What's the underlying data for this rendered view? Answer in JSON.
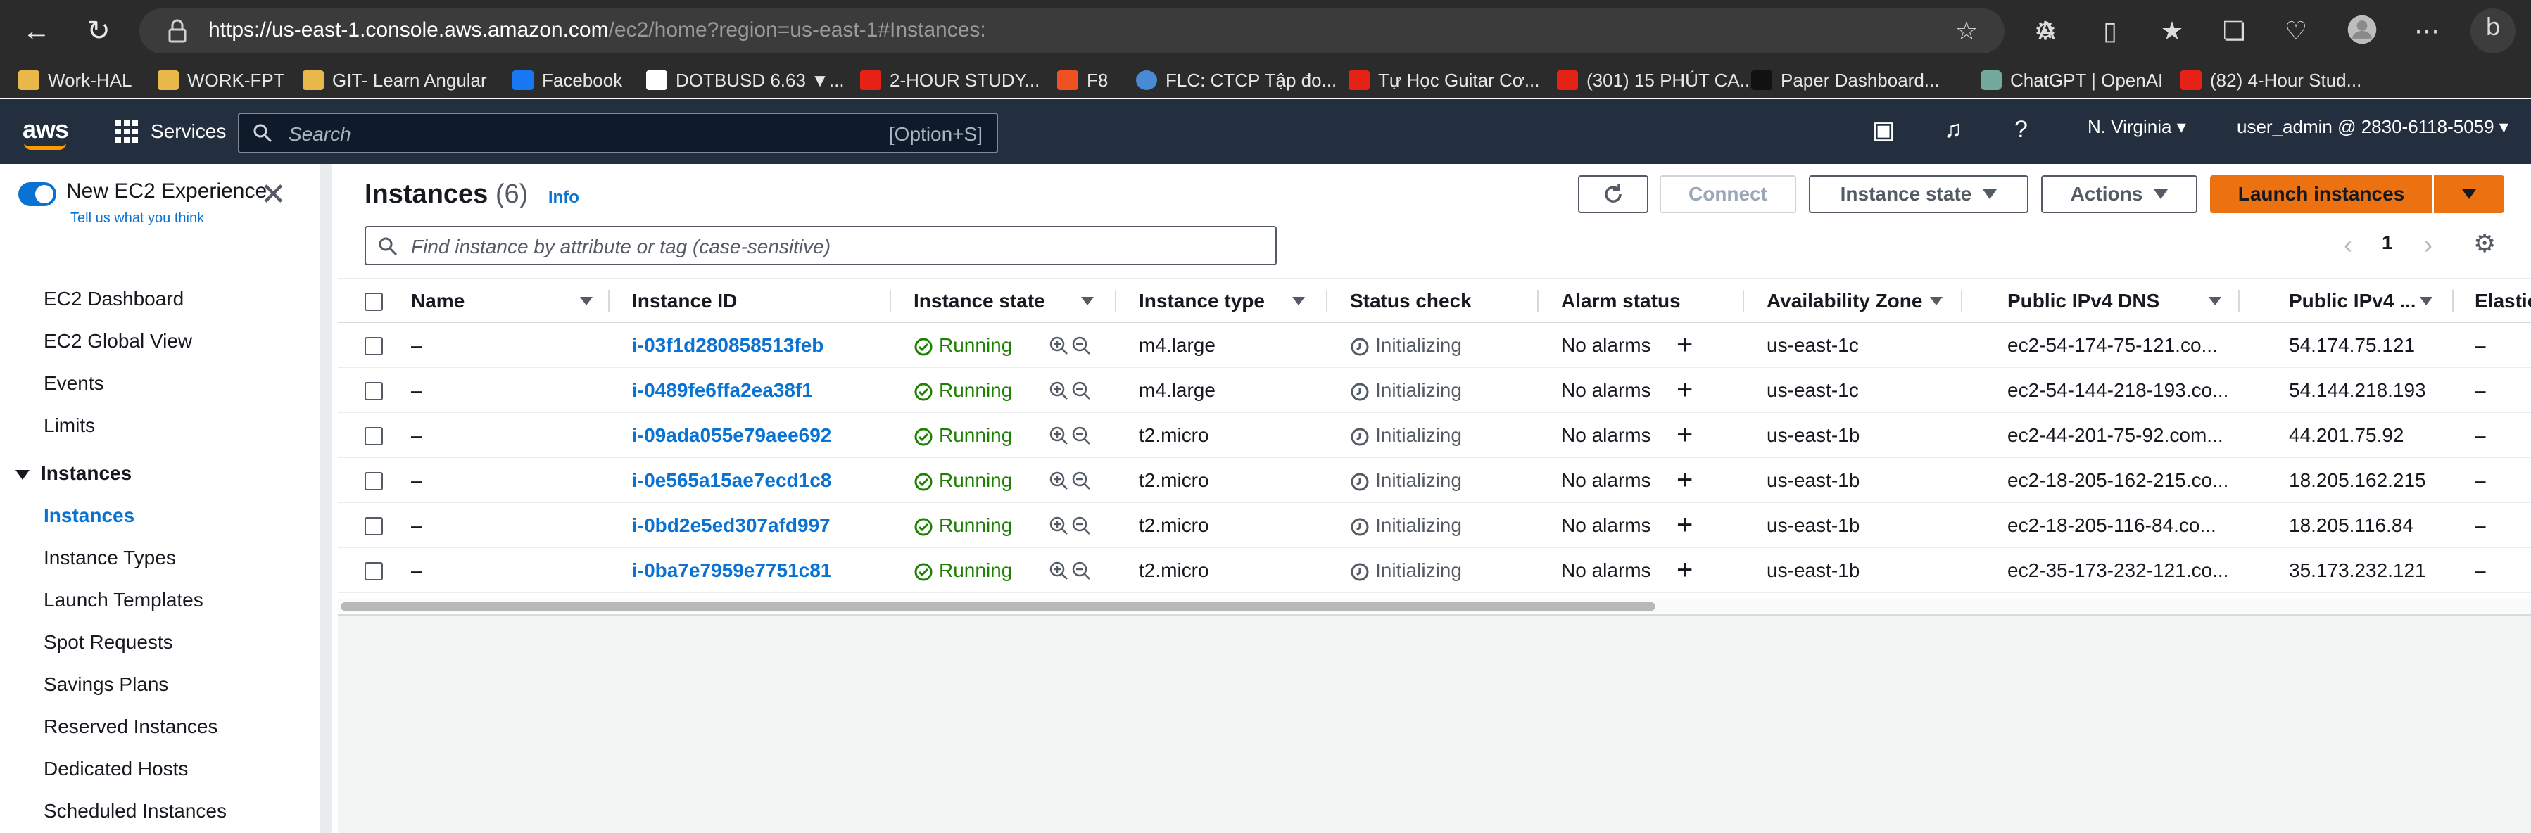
{
  "browser": {
    "url_host": "https://us-east-1.console.aws.amazon.com",
    "url_path": "/ec2/home?region=us-east-1#Instances:",
    "bookmarks": [
      {
        "label": "Work-HAL",
        "icon": "folder-icon"
      },
      {
        "label": "WORK-FPT",
        "icon": "folder-icon"
      },
      {
        "label": "GIT- Learn Angular",
        "icon": "folder-icon"
      },
      {
        "label": "Facebook",
        "icon": "facebook-icon"
      },
      {
        "label": "DOTBUSD 6.63 ▼...",
        "icon": "tradingview-icon"
      },
      {
        "label": "2-HOUR STUDY...",
        "icon": "youtube-icon"
      },
      {
        "label": "F8",
        "icon": "f8-icon"
      },
      {
        "label": "FLC: CTCP Tập đo...",
        "icon": "globe-icon"
      },
      {
        "label": "Tự Học Guitar Cơ...",
        "icon": "youtube-icon"
      },
      {
        "label": "(301) 15 PHÚT CA...",
        "icon": "youtube-icon"
      },
      {
        "label": "Paper Dashboard...",
        "icon": "bow-icon"
      },
      {
        "label": "ChatGPT | OpenAI",
        "icon": "openai-icon"
      },
      {
        "label": "(82) 4-Hour Stud...",
        "icon": "youtube-icon"
      }
    ]
  },
  "aws_nav": {
    "logo": "aws",
    "services": "Services",
    "search_placeholder": "Search",
    "search_shortcut": "[Option+S]",
    "region": "N. Virginia",
    "account": "user_admin @ 2830-6118-5059"
  },
  "sidebar": {
    "new_experience": "New EC2 Experience",
    "tell_us": "Tell us what you think",
    "top_items": [
      "EC2 Dashboard",
      "EC2 Global View",
      "Events",
      "Limits"
    ],
    "section": "Instances",
    "section_items": [
      "Instances",
      "Instance Types",
      "Launch Templates",
      "Spot Requests",
      "Savings Plans",
      "Reserved Instances",
      "Dedicated Hosts",
      "Scheduled Instances"
    ]
  },
  "panel": {
    "title": "Instances",
    "count": "(6)",
    "info": "Info",
    "connect": "Connect",
    "instance_state": "Instance state",
    "actions": "Actions",
    "launch": "Launch instances",
    "filter_placeholder": "Find instance by attribute or tag (case-sensitive)",
    "page": "1"
  },
  "table": {
    "columns": [
      "Name",
      "Instance ID",
      "Instance state",
      "Instance type",
      "Status check",
      "Alarm status",
      "Availability Zone",
      "Public IPv4 DNS",
      "Public IPv4 ...",
      "Elastic"
    ],
    "rows": [
      {
        "name": "–",
        "id": "i-03f1d280858513feb",
        "state": "Running",
        "type": "m4.large",
        "status": "Initializing",
        "alarm": "No alarms",
        "az": "us-east-1c",
        "dns": "ec2-54-174-75-121.co...",
        "ip": "54.174.75.121",
        "elastic": "–"
      },
      {
        "name": "–",
        "id": "i-0489fe6ffa2ea38f1",
        "state": "Running",
        "type": "m4.large",
        "status": "Initializing",
        "alarm": "No alarms",
        "az": "us-east-1c",
        "dns": "ec2-54-144-218-193.co...",
        "ip": "54.144.218.193",
        "elastic": "–"
      },
      {
        "name": "–",
        "id": "i-09ada055e79aee692",
        "state": "Running",
        "type": "t2.micro",
        "status": "Initializing",
        "alarm": "No alarms",
        "az": "us-east-1b",
        "dns": "ec2-44-201-75-92.com...",
        "ip": "44.201.75.92",
        "elastic": "–"
      },
      {
        "name": "–",
        "id": "i-0e565a15ae7ecd1c8",
        "state": "Running",
        "type": "t2.micro",
        "status": "Initializing",
        "alarm": "No alarms",
        "az": "us-east-1b",
        "dns": "ec2-18-205-162-215.co...",
        "ip": "18.205.162.215",
        "elastic": "–"
      },
      {
        "name": "–",
        "id": "i-0bd2e5ed307afd997",
        "state": "Running",
        "type": "t2.micro",
        "status": "Initializing",
        "alarm": "No alarms",
        "az": "us-east-1b",
        "dns": "ec2-18-205-116-84.co...",
        "ip": "18.205.116.84",
        "elastic": "–"
      },
      {
        "name": "–",
        "id": "i-0ba7e7959e7751c81",
        "state": "Running",
        "type": "t2.micro",
        "status": "Initializing",
        "alarm": "No alarms",
        "az": "us-east-1b",
        "dns": "ec2-35-173-232-121.co...",
        "ip": "35.173.232.121",
        "elastic": "–"
      }
    ]
  },
  "colors": {
    "aws_nav": "#232f3e",
    "link": "#0972d3",
    "running": "#1d8102",
    "launch": "#ec7211"
  }
}
